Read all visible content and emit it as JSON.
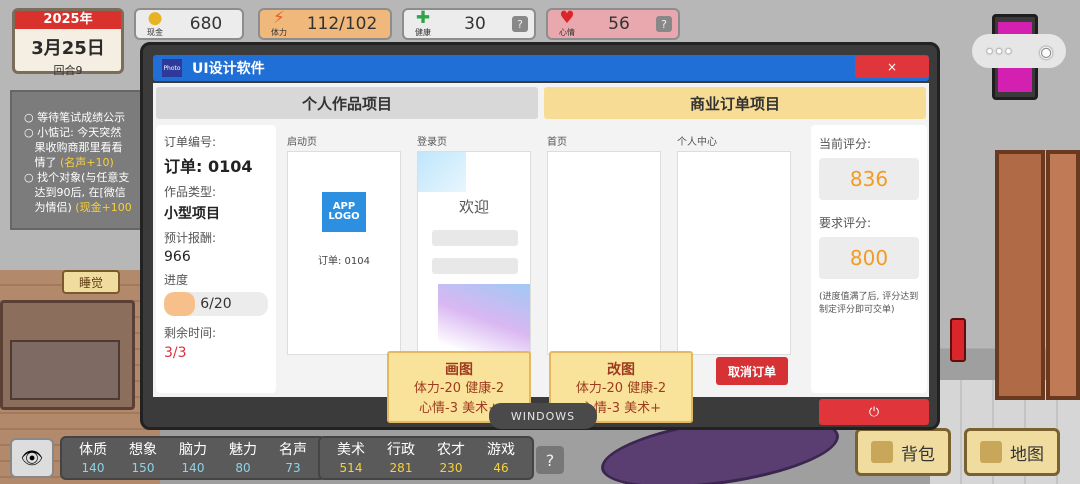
{
  "date": {
    "year": "2025年",
    "day": "3月25日",
    "round": "回合9"
  },
  "stats": {
    "cash": {
      "label": "现金",
      "value": "680",
      "icon": "coin-icon"
    },
    "energy": {
      "label": "体力",
      "value": "112/102",
      "icon": "lightning-icon"
    },
    "health": {
      "label": "健康",
      "value": "30",
      "icon": "cross-icon"
    },
    "mood": {
      "label": "心情",
      "value": "56",
      "icon": "heart-icon"
    }
  },
  "messages": {
    "line1": "等待笔试成绩公示",
    "line2a": "小惦记: 今天突然",
    "line2b": "果收购商那里看看",
    "line2c": "情了",
    "line2d": "(名声+10)",
    "line3a": "找个对象(与任意支",
    "line3b": "达到90后, 在[微信",
    "line3c": "为情侣)",
    "line3d": "(现金+100"
  },
  "sleep_label": "睡觉",
  "window": {
    "app_icon_text": "Photo",
    "title": "UI设计软件",
    "close": "×",
    "tabs": {
      "personal": "个人作品项目",
      "commercial": "商业订单项目"
    },
    "order": {
      "id_label": "订单编号:",
      "id_value": "订单: 0104",
      "type_label": "作品类型:",
      "type_value": "小型项目",
      "reward_label": "预计报酬:",
      "reward_value": "966",
      "progress_label": "进度",
      "progress_text": "6/20",
      "progress_fraction": 0.3,
      "remain_label": "剩余时间:",
      "remain_value": "3/3"
    },
    "pages": {
      "splash": {
        "label": "启动页",
        "logo": "APP LOGO",
        "order": "订单: 0104"
      },
      "login": {
        "label": "登录页",
        "welcome": "欢迎"
      },
      "home": {
        "label": "首页"
      },
      "profile": {
        "label": "个人中心"
      }
    },
    "actions": {
      "draw": {
        "title": "画图",
        "line1": "体力-20 健康-2",
        "line2": "心情-3 美术+"
      },
      "revise": {
        "title": "改图",
        "line1": "体力-20 健康-2",
        "line2": "心情-3 美术+"
      }
    },
    "cancel": "取消订单",
    "scores": {
      "current_label": "当前评分:",
      "current_value": "836",
      "required_label": "要求评分:",
      "required_value": "800",
      "note": "(进度值满了后, 评分达到制定评分即可交单)"
    },
    "taskbar": "WINDOWS",
    "power": "⏻"
  },
  "attributes": [
    {
      "label": "体质",
      "value": "140"
    },
    {
      "label": "想象",
      "value": "150"
    },
    {
      "label": "脑力",
      "value": "140"
    },
    {
      "label": "魅力",
      "value": "80"
    },
    {
      "label": "名声",
      "value": "73"
    }
  ],
  "skills": [
    {
      "label": "美术",
      "value": "514"
    },
    {
      "label": "行政",
      "value": "281"
    },
    {
      "label": "农才",
      "value": "230"
    },
    {
      "label": "游戏",
      "value": "46"
    }
  ],
  "bag_label": "背包",
  "map_label": "地图",
  "colors": {
    "accent_blue": "#1f6fd6",
    "danger_red": "#e0353a",
    "commercial_tab": "#f7dc95",
    "score_orange": "#f39b25"
  }
}
